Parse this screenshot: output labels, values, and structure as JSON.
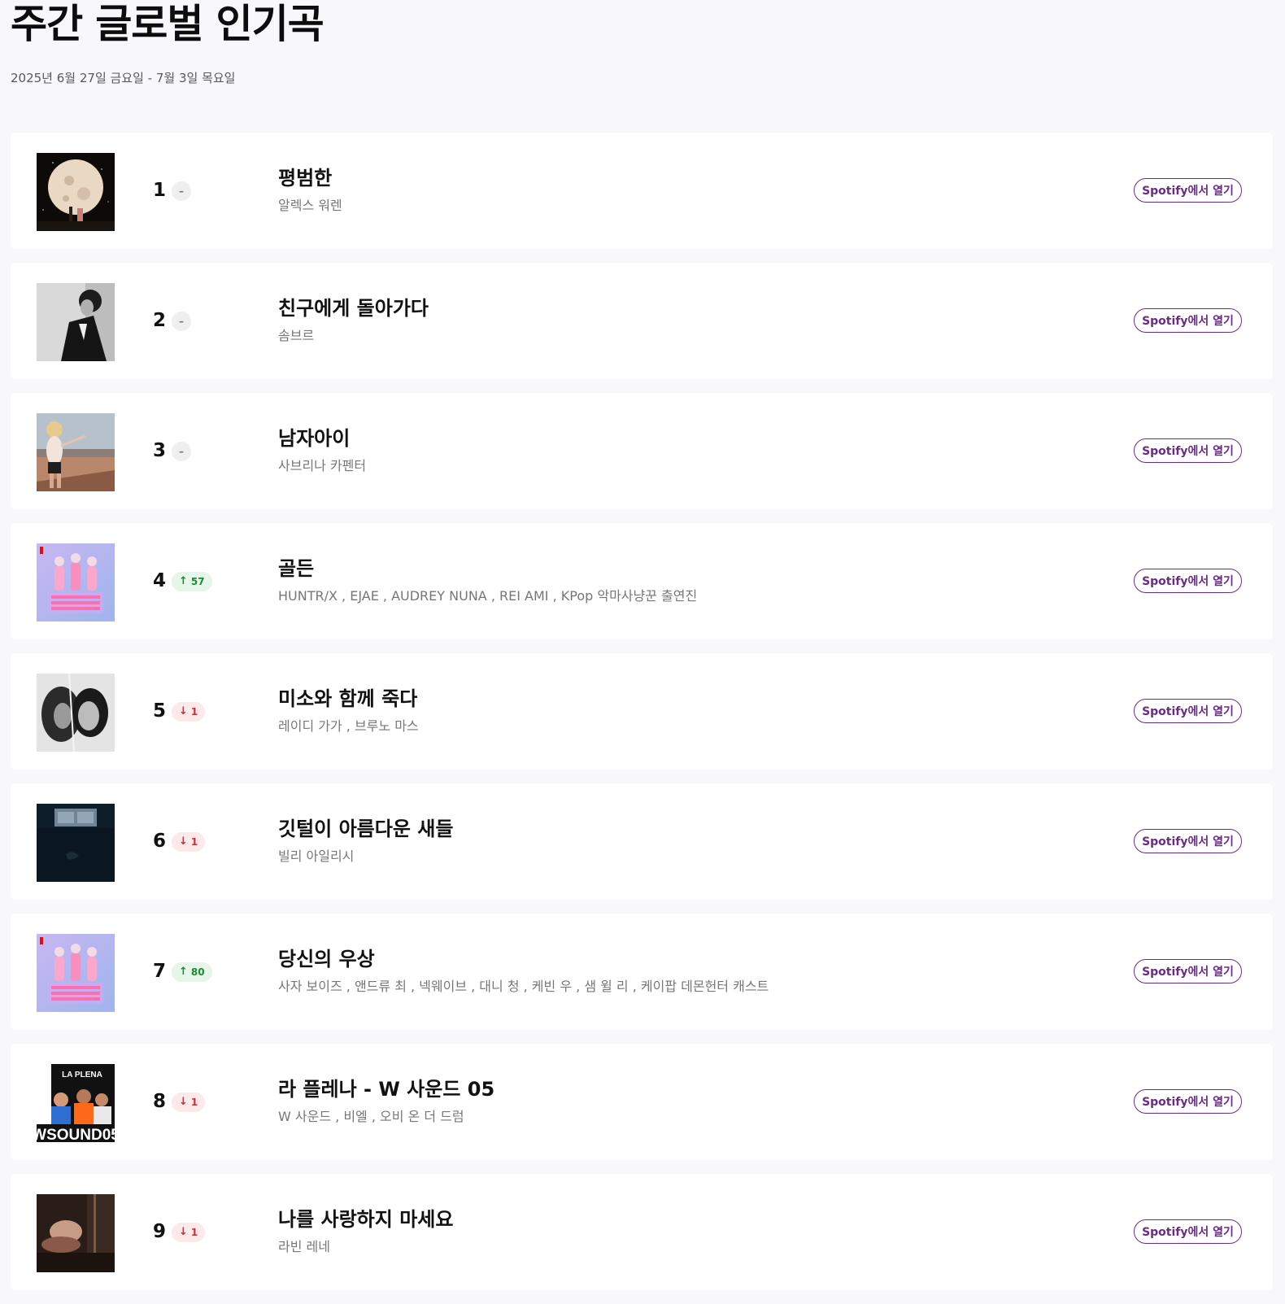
{
  "header": {
    "title": "주간 글로벌 인기곡",
    "date_range": "2025년 6월 27일 금요일 - 7월 3일 목요일"
  },
  "colors": {
    "background": "#f8f7fa",
    "card": "#ffffff",
    "accent": "#6b2a86",
    "up": "#1c8a3a",
    "down": "#d02a3c",
    "same": "#777777"
  },
  "tracks": [
    {
      "rank": "1",
      "change": "same",
      "change_label": "–",
      "title": "평범한",
      "artists": "알렉스 워렌",
      "cover": "moon-cover-art",
      "button_label": "Spotify에서 열기"
    },
    {
      "rank": "2",
      "change": "same",
      "change_label": "–",
      "title": "친구에게 돌아가다",
      "artists": "솜브르",
      "cover": "bw-portrait-cover-art",
      "button_label": "Spotify에서 열기"
    },
    {
      "rank": "3",
      "change": "same",
      "change_label": "–",
      "title": "남자아이",
      "artists": "사브리나 카펜터",
      "cover": "desert-cover-art",
      "button_label": "Spotify에서 열기"
    },
    {
      "rank": "4",
      "change": "up",
      "change_label": "57",
      "title": "골든",
      "artists": "HUNTR/X , EJAE , AUDREY NUNA , REI AMI , KPop 악마사냥꾼 출연진",
      "cover": "kpop-demon-hunters-cover-art",
      "button_label": "Spotify에서 열기"
    },
    {
      "rank": "5",
      "change": "down",
      "change_label": "1",
      "title": "미소와 함께 죽다",
      "artists": "레이디 가가 , 브루노 마스",
      "cover": "bw-faces-cover-art",
      "button_label": "Spotify에서 열기"
    },
    {
      "rank": "6",
      "change": "down",
      "change_label": "1",
      "title": "깃털이 아름다운 새들",
      "artists": "빌리 아일리시",
      "cover": "underwater-cover-art",
      "button_label": "Spotify에서 열기"
    },
    {
      "rank": "7",
      "change": "up",
      "change_label": "80",
      "title": "당신의 우상",
      "artists": "사자 보이즈 , 앤드류 최 , 넥웨이브 , 대니 청 , 케빈 우 , 샘 윌 리 , 케이팝 데몬헌터 캐스트",
      "cover": "kpop-demon-hunters-cover-art",
      "button_label": "Spotify에서 열기"
    },
    {
      "rank": "8",
      "change": "down",
      "change_label": "1",
      "title": "라 플레나 - W 사운드 05",
      "artists": "W 사운드 , 비엘 , 오비 온 더 드럼",
      "cover": "la-plena-cover-art",
      "button_label": "Spotify에서 열기",
      "cover_text_top": "LA PLENA",
      "cover_text_bottom": "WSOUND05"
    },
    {
      "rank": "9",
      "change": "down",
      "change_label": "1",
      "title": "나를 사랑하지 마세요",
      "artists": "라빈 레네",
      "cover": "dark-portrait-cover-art",
      "button_label": "Spotify에서 열기"
    }
  ]
}
